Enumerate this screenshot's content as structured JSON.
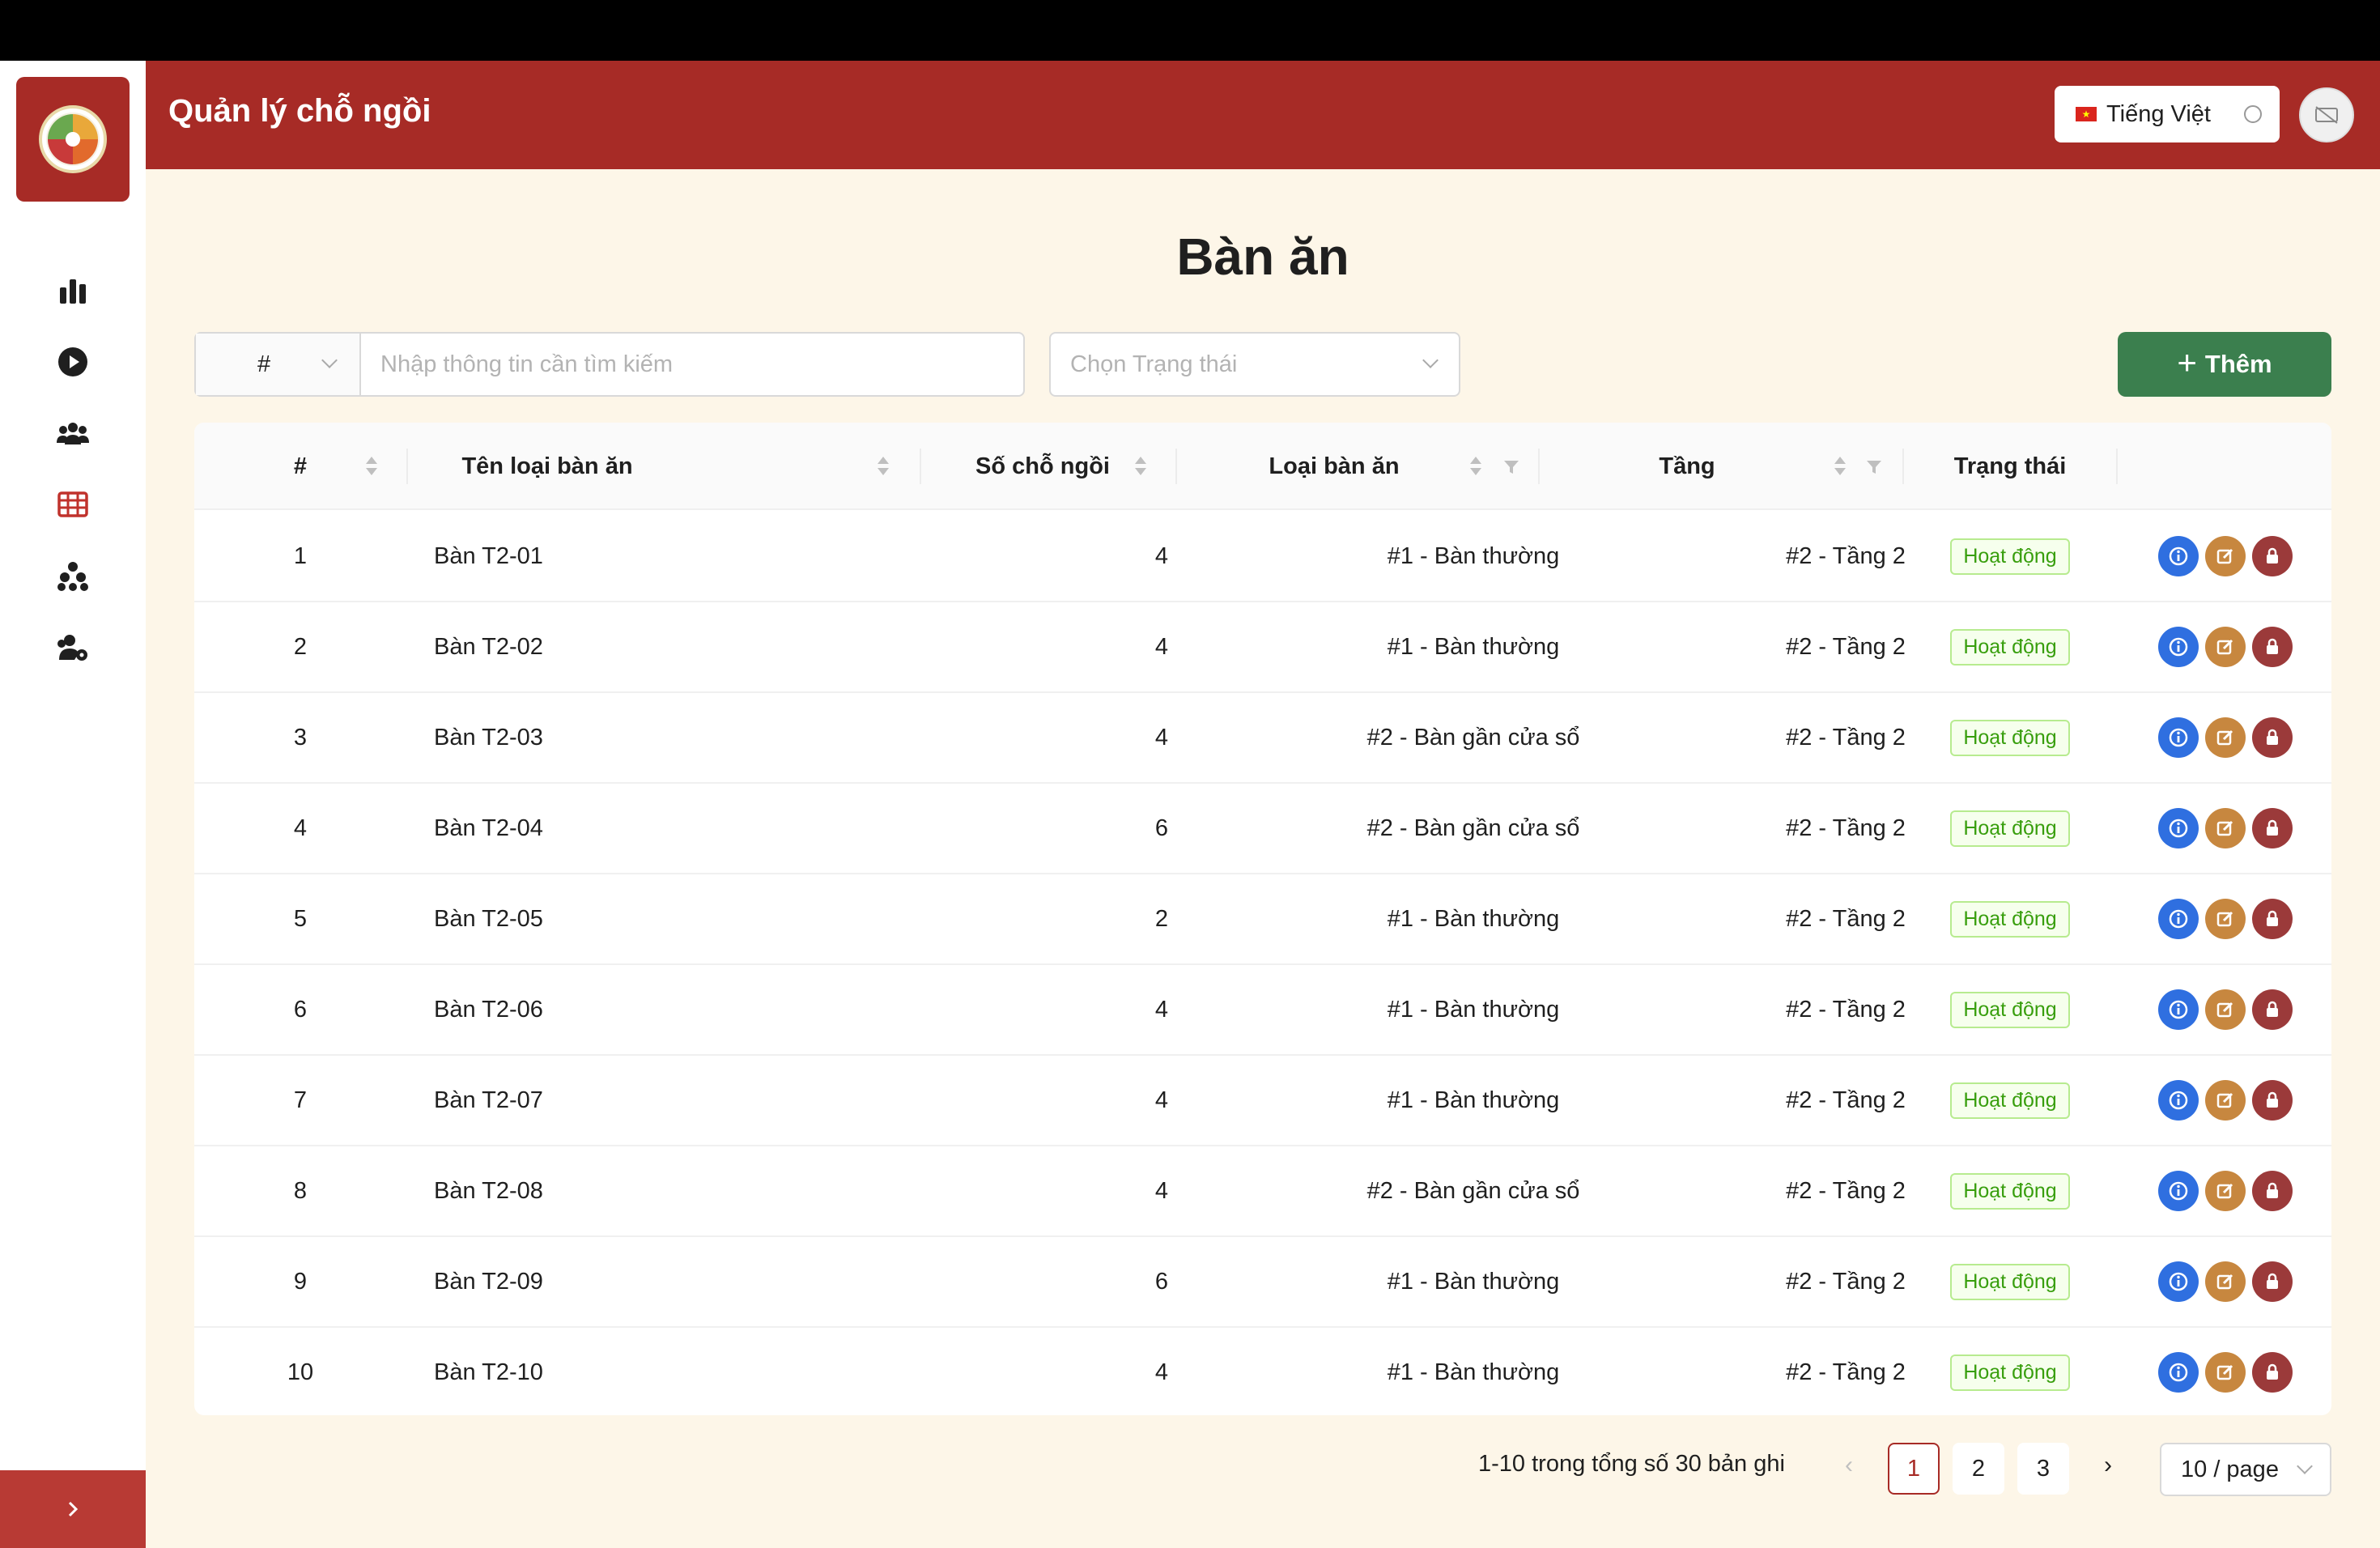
{
  "app": {
    "title": "Quản lý chỗ ngồi"
  },
  "header": {
    "language": "Tiếng Việt",
    "flag": "★"
  },
  "sidebar": {
    "items": [
      {
        "icon": "bar-chart-icon"
      },
      {
        "icon": "play-circle-icon"
      },
      {
        "icon": "team-icon"
      },
      {
        "icon": "table-icon",
        "active": true
      },
      {
        "icon": "cluster-icon"
      },
      {
        "icon": "user-settings-icon"
      }
    ]
  },
  "page": {
    "title": "Bàn ăn"
  },
  "filters": {
    "search_prefix": "#",
    "search_placeholder": "Nhập thông tin cần tìm kiếm",
    "status_placeholder": "Chọn Trạng thái",
    "add_label": "Thêm",
    "add_icon": "+"
  },
  "table": {
    "columns": [
      "#",
      "Tên loại bàn ăn",
      "Số chỗ ngồi",
      "Loại bàn ăn",
      "Tầng",
      "Trạng thái"
    ],
    "rows": [
      {
        "no": "1",
        "name": "Bàn T2-01",
        "seats": "4",
        "type": "#1 - Bàn thường",
        "floor": "#2 - Tầng 2",
        "status": "Hoạt động"
      },
      {
        "no": "2",
        "name": "Bàn T2-02",
        "seats": "4",
        "type": "#1 - Bàn thường",
        "floor": "#2 - Tầng 2",
        "status": "Hoạt động"
      },
      {
        "no": "3",
        "name": "Bàn T2-03",
        "seats": "4",
        "type": "#2 - Bàn gần cửa sổ",
        "floor": "#2 - Tầng 2",
        "status": "Hoạt động"
      },
      {
        "no": "4",
        "name": "Bàn T2-04",
        "seats": "6",
        "type": "#2 - Bàn gần cửa sổ",
        "floor": "#2 - Tầng 2",
        "status": "Hoạt động"
      },
      {
        "no": "5",
        "name": "Bàn T2-05",
        "seats": "2",
        "type": "#1 - Bàn thường",
        "floor": "#2 - Tầng 2",
        "status": "Hoạt động"
      },
      {
        "no": "6",
        "name": "Bàn T2-06",
        "seats": "4",
        "type": "#1 - Bàn thường",
        "floor": "#2 - Tầng 2",
        "status": "Hoạt động"
      },
      {
        "no": "7",
        "name": "Bàn T2-07",
        "seats": "4",
        "type": "#1 - Bàn thường",
        "floor": "#2 - Tầng 2",
        "status": "Hoạt động"
      },
      {
        "no": "8",
        "name": "Bàn T2-08",
        "seats": "4",
        "type": "#2 - Bàn gần cửa sổ",
        "floor": "#2 - Tầng 2",
        "status": "Hoạt động"
      },
      {
        "no": "9",
        "name": "Bàn T2-09",
        "seats": "6",
        "type": "#1 - Bàn thường",
        "floor": "#2 - Tầng 2",
        "status": "Hoạt động"
      },
      {
        "no": "10",
        "name": "Bàn T2-10",
        "seats": "4",
        "type": "#1 - Bàn thường",
        "floor": "#2 - Tầng 2",
        "status": "Hoạt động"
      }
    ]
  },
  "pagination": {
    "summary": "1-10 trong tổng số 30 bản ghi",
    "pages": [
      "1",
      "2",
      "3"
    ],
    "current": "1",
    "page_size": "10 / page",
    "prev": "‹",
    "next": "›"
  },
  "colors": {
    "brand": "#a72b26",
    "accent_green": "#3b7f4e",
    "info": "#2f6fe0",
    "edit": "#c7873f",
    "lock": "#9b3a3a"
  }
}
